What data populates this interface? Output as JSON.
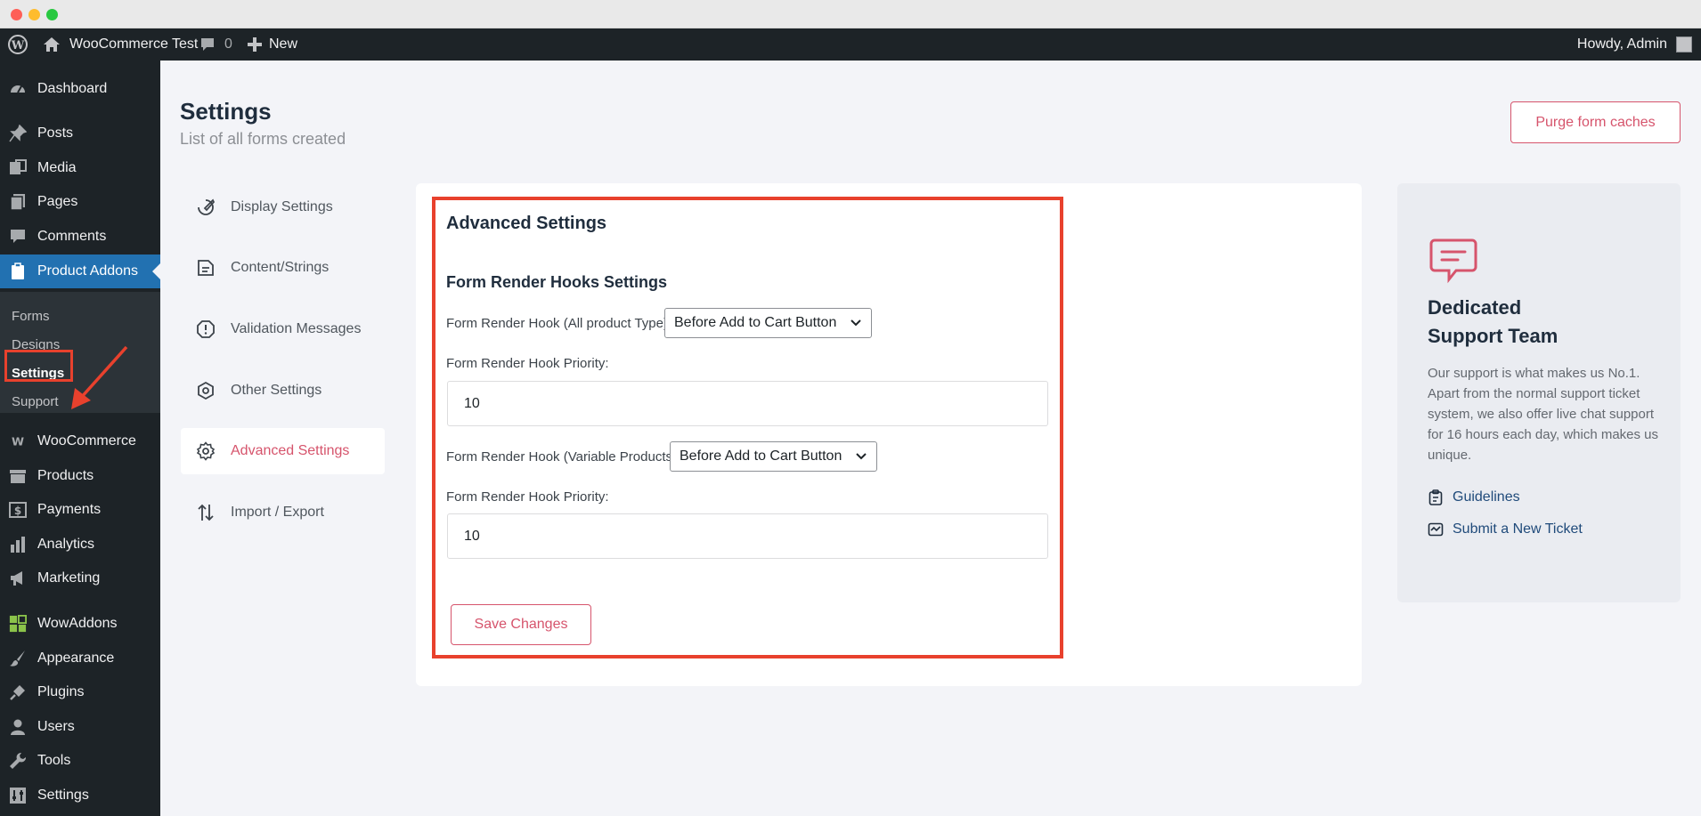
{
  "adminbar": {
    "site_name": "WooCommerce Test",
    "comment_count": "0",
    "new_label": "New",
    "howdy": "Howdy, Admin"
  },
  "sidebar": {
    "items": [
      {
        "label": "Dashboard",
        "icon": "dashboard-icon"
      },
      {
        "label": "Posts",
        "icon": "pin-icon"
      },
      {
        "label": "Media",
        "icon": "media-icon"
      },
      {
        "label": "Pages",
        "icon": "pages-icon"
      },
      {
        "label": "Comments",
        "icon": "comment-icon"
      },
      {
        "label": "Product Addons",
        "icon": "clipboard-icon"
      },
      {
        "label": "WooCommerce",
        "icon": "woo-icon"
      },
      {
        "label": "Products",
        "icon": "archive-icon"
      },
      {
        "label": "Payments",
        "icon": "dollar-icon"
      },
      {
        "label": "Analytics",
        "icon": "bar-chart-icon"
      },
      {
        "label": "Marketing",
        "icon": "megaphone-icon"
      },
      {
        "label": "WowAddons",
        "icon": "grid-icon"
      },
      {
        "label": "Appearance",
        "icon": "brush-icon"
      },
      {
        "label": "Plugins",
        "icon": "plug-icon"
      },
      {
        "label": "Users",
        "icon": "user-icon"
      },
      {
        "label": "Tools",
        "icon": "wrench-icon"
      },
      {
        "label": "Settings",
        "icon": "sliders-icon"
      }
    ],
    "submenu": [
      "Forms",
      "Designs",
      "Settings",
      "Support"
    ]
  },
  "header": {
    "title": "Settings",
    "subtitle": "List of all forms created",
    "purge_label": "Purge form caches"
  },
  "tabs": [
    {
      "label": "Display Settings"
    },
    {
      "label": "Content/Strings"
    },
    {
      "label": "Validation Messages"
    },
    {
      "label": "Other Settings"
    },
    {
      "label": "Advanced Settings"
    },
    {
      "label": "Import / Export"
    }
  ],
  "advanced": {
    "title": "Advanced Settings",
    "section_title": "Form Render Hooks Settings",
    "hook_all_label": "Form Render Hook (All product Type)",
    "hook_all_value": "Before Add to Cart Button",
    "priority_label": "Form Render Hook Priority:",
    "priority_all_value": "10",
    "hook_variable_label": "Form Render Hook (Variable Products)",
    "hook_variable_value": "Before Add to Cart Button",
    "priority_variable_value": "10",
    "save_label": "Save Changes"
  },
  "support": {
    "title_line1": "Dedicated",
    "title_line2": "Support Team",
    "description": "Our support is what makes us No.1. Apart from the normal support ticket system, we also offer live chat support for 16 hours each day, which makes us unique.",
    "guidelines_label": "Guidelines",
    "ticket_label": "Submit a New Ticket"
  },
  "colors": {
    "accent": "#d6546c",
    "admin_dark": "#1d2327",
    "wp_blue": "#2271b1",
    "annotation_red": "#e8412d"
  }
}
